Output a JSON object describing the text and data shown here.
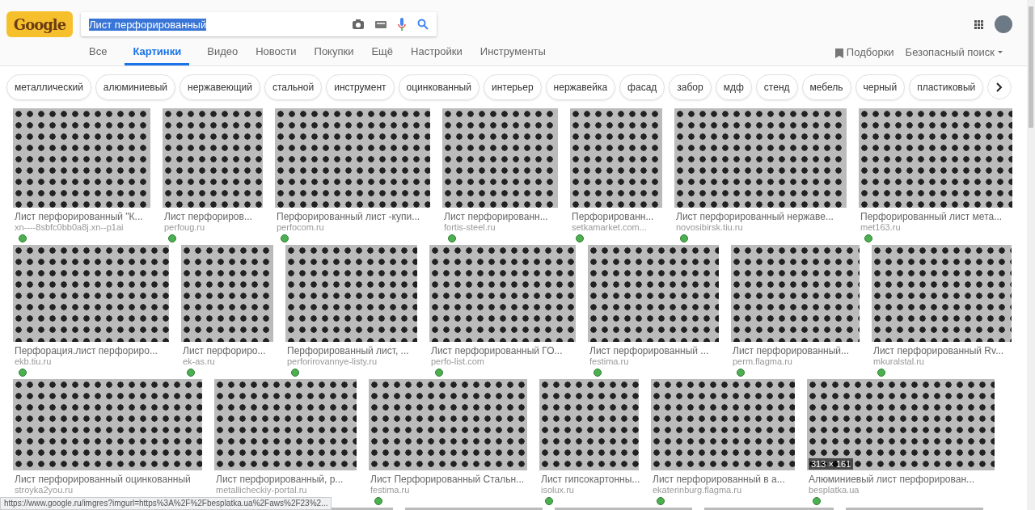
{
  "logo": "Google",
  "search": {
    "value": "Лист перфорированный"
  },
  "tabs": [
    {
      "label": "Все",
      "selected": false
    },
    {
      "label": "Картинки",
      "selected": true
    },
    {
      "label": "Видео",
      "selected": false
    },
    {
      "label": "Новости",
      "selected": false
    },
    {
      "label": "Покупки",
      "selected": false
    },
    {
      "label": "Ещё",
      "selected": false
    },
    {
      "label": "Настройки",
      "selected": false
    },
    {
      "label": "Инструменты",
      "selected": false
    }
  ],
  "collections": "Подборки",
  "safe_search": "Безопасный поиск",
  "chips": [
    "металлический",
    "алюминиевый",
    "нержавеющий",
    "стальной",
    "инструмент",
    "оцинкованный",
    "интерьер",
    "нержавейка",
    "фасад",
    "забор",
    "мдф",
    "стенд",
    "мебель",
    "черный",
    "пластиковый"
  ],
  "rows": [
    [
      {
        "title": "Лист перфорированный \"К...",
        "site": "xn----8sbfc0bb0a8j.xn--p1ai"
      },
      {
        "title": "Лист перфориров...",
        "site": "perfoug.ru"
      },
      {
        "title": "Перфорированный лист -купи...",
        "site": "perfocom.ru"
      },
      {
        "title": "Лист перфорированн...",
        "site": "fortis-steel.ru"
      },
      {
        "title": "Перфорированн...",
        "site": "setkamarket.com..."
      },
      {
        "title": "Лист перфорированный нержаве...",
        "site": "novosibirsk.tiu.ru"
      },
      {
        "title": "Перфорированный лист мета...",
        "site": "met163.ru"
      }
    ],
    [
      {
        "title": "Перфорация.лист перфориро...",
        "site": "ekb.tiu.ru"
      },
      {
        "title": "Лист перфориро...",
        "site": "ek-as.ru"
      },
      {
        "title": "Перфорированный лист, ...",
        "site": "perforirovannye-listy.ru"
      },
      {
        "title": "Лист перфорированный ГО...",
        "site": "perfo-list.com"
      },
      {
        "title": "Лист перфорированный ...",
        "site": "festima.ru"
      },
      {
        "title": "Лист перфорированный...",
        "site": "perm.flagma.ru"
      },
      {
        "title": "Лист перфорированный Rv...",
        "site": "mkuralstal.ru"
      }
    ],
    [
      {
        "title": "Лист перфорированный оцинкованный",
        "site": "stroyka2you.ru"
      },
      {
        "title": "Лист перфорированный, р...",
        "site": "metallicheckiy-portal.ru"
      },
      {
        "title": "Лист Перфорированный Стальн...",
        "site": "festima.ru"
      },
      {
        "title": "Лист гипсокартонны...",
        "site": "isolux.ru"
      },
      {
        "title": "Лист перфорированный в а...",
        "site": "ekaterinburg.flagma.ru"
      },
      {
        "title": "Алюминиевый лист перфорирован...",
        "site": "besplatka.ua",
        "size": "313 × 161"
      }
    ]
  ],
  "status_url": "https://www.google.ru/imgres?imgurl=https%3A%2F%2Fbesplatka.ua%2Faws%2F23%2..."
}
